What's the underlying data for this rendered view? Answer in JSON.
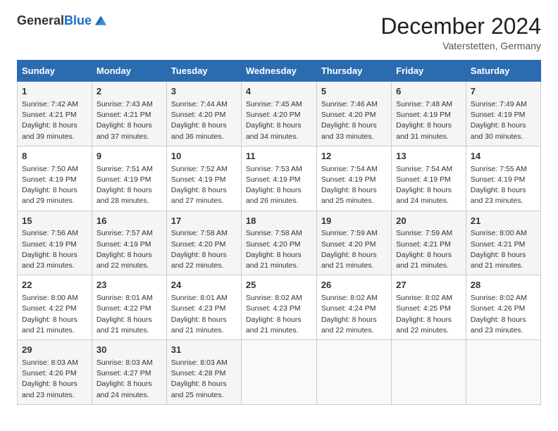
{
  "header": {
    "logo_general": "General",
    "logo_blue": "Blue",
    "month_title": "December 2024",
    "location": "Vaterstetten, Germany"
  },
  "days_of_week": [
    "Sunday",
    "Monday",
    "Tuesday",
    "Wednesday",
    "Thursday",
    "Friday",
    "Saturday"
  ],
  "weeks": [
    [
      {
        "day": 1,
        "sunrise": "Sunrise: 7:42 AM",
        "sunset": "Sunset: 4:21 PM",
        "daylight": "Daylight: 8 hours and 39 minutes."
      },
      {
        "day": 2,
        "sunrise": "Sunrise: 7:43 AM",
        "sunset": "Sunset: 4:21 PM",
        "daylight": "Daylight: 8 hours and 37 minutes."
      },
      {
        "day": 3,
        "sunrise": "Sunrise: 7:44 AM",
        "sunset": "Sunset: 4:20 PM",
        "daylight": "Daylight: 8 hours and 36 minutes."
      },
      {
        "day": 4,
        "sunrise": "Sunrise: 7:45 AM",
        "sunset": "Sunset: 4:20 PM",
        "daylight": "Daylight: 8 hours and 34 minutes."
      },
      {
        "day": 5,
        "sunrise": "Sunrise: 7:46 AM",
        "sunset": "Sunset: 4:20 PM",
        "daylight": "Daylight: 8 hours and 33 minutes."
      },
      {
        "day": 6,
        "sunrise": "Sunrise: 7:48 AM",
        "sunset": "Sunset: 4:19 PM",
        "daylight": "Daylight: 8 hours and 31 minutes."
      },
      {
        "day": 7,
        "sunrise": "Sunrise: 7:49 AM",
        "sunset": "Sunset: 4:19 PM",
        "daylight": "Daylight: 8 hours and 30 minutes."
      }
    ],
    [
      {
        "day": 8,
        "sunrise": "Sunrise: 7:50 AM",
        "sunset": "Sunset: 4:19 PM",
        "daylight": "Daylight: 8 hours and 29 minutes."
      },
      {
        "day": 9,
        "sunrise": "Sunrise: 7:51 AM",
        "sunset": "Sunset: 4:19 PM",
        "daylight": "Daylight: 8 hours and 28 minutes."
      },
      {
        "day": 10,
        "sunrise": "Sunrise: 7:52 AM",
        "sunset": "Sunset: 4:19 PM",
        "daylight": "Daylight: 8 hours and 27 minutes."
      },
      {
        "day": 11,
        "sunrise": "Sunrise: 7:53 AM",
        "sunset": "Sunset: 4:19 PM",
        "daylight": "Daylight: 8 hours and 26 minutes."
      },
      {
        "day": 12,
        "sunrise": "Sunrise: 7:54 AM",
        "sunset": "Sunset: 4:19 PM",
        "daylight": "Daylight: 8 hours and 25 minutes."
      },
      {
        "day": 13,
        "sunrise": "Sunrise: 7:54 AM",
        "sunset": "Sunset: 4:19 PM",
        "daylight": "Daylight: 8 hours and 24 minutes."
      },
      {
        "day": 14,
        "sunrise": "Sunrise: 7:55 AM",
        "sunset": "Sunset: 4:19 PM",
        "daylight": "Daylight: 8 hours and 23 minutes."
      }
    ],
    [
      {
        "day": 15,
        "sunrise": "Sunrise: 7:56 AM",
        "sunset": "Sunset: 4:19 PM",
        "daylight": "Daylight: 8 hours and 23 minutes."
      },
      {
        "day": 16,
        "sunrise": "Sunrise: 7:57 AM",
        "sunset": "Sunset: 4:19 PM",
        "daylight": "Daylight: 8 hours and 22 minutes."
      },
      {
        "day": 17,
        "sunrise": "Sunrise: 7:58 AM",
        "sunset": "Sunset: 4:20 PM",
        "daylight": "Daylight: 8 hours and 22 minutes."
      },
      {
        "day": 18,
        "sunrise": "Sunrise: 7:58 AM",
        "sunset": "Sunset: 4:20 PM",
        "daylight": "Daylight: 8 hours and 21 minutes."
      },
      {
        "day": 19,
        "sunrise": "Sunrise: 7:59 AM",
        "sunset": "Sunset: 4:20 PM",
        "daylight": "Daylight: 8 hours and 21 minutes."
      },
      {
        "day": 20,
        "sunrise": "Sunrise: 7:59 AM",
        "sunset": "Sunset: 4:21 PM",
        "daylight": "Daylight: 8 hours and 21 minutes."
      },
      {
        "day": 21,
        "sunrise": "Sunrise: 8:00 AM",
        "sunset": "Sunset: 4:21 PM",
        "daylight": "Daylight: 8 hours and 21 minutes."
      }
    ],
    [
      {
        "day": 22,
        "sunrise": "Sunrise: 8:00 AM",
        "sunset": "Sunset: 4:22 PM",
        "daylight": "Daylight: 8 hours and 21 minutes."
      },
      {
        "day": 23,
        "sunrise": "Sunrise: 8:01 AM",
        "sunset": "Sunset: 4:22 PM",
        "daylight": "Daylight: 8 hours and 21 minutes."
      },
      {
        "day": 24,
        "sunrise": "Sunrise: 8:01 AM",
        "sunset": "Sunset: 4:23 PM",
        "daylight": "Daylight: 8 hours and 21 minutes."
      },
      {
        "day": 25,
        "sunrise": "Sunrise: 8:02 AM",
        "sunset": "Sunset: 4:23 PM",
        "daylight": "Daylight: 8 hours and 21 minutes."
      },
      {
        "day": 26,
        "sunrise": "Sunrise: 8:02 AM",
        "sunset": "Sunset: 4:24 PM",
        "daylight": "Daylight: 8 hours and 22 minutes."
      },
      {
        "day": 27,
        "sunrise": "Sunrise: 8:02 AM",
        "sunset": "Sunset: 4:25 PM",
        "daylight": "Daylight: 8 hours and 22 minutes."
      },
      {
        "day": 28,
        "sunrise": "Sunrise: 8:02 AM",
        "sunset": "Sunset: 4:26 PM",
        "daylight": "Daylight: 8 hours and 23 minutes."
      }
    ],
    [
      {
        "day": 29,
        "sunrise": "Sunrise: 8:03 AM",
        "sunset": "Sunset: 4:26 PM",
        "daylight": "Daylight: 8 hours and 23 minutes."
      },
      {
        "day": 30,
        "sunrise": "Sunrise: 8:03 AM",
        "sunset": "Sunset: 4:27 PM",
        "daylight": "Daylight: 8 hours and 24 minutes."
      },
      {
        "day": 31,
        "sunrise": "Sunrise: 8:03 AM",
        "sunset": "Sunset: 4:28 PM",
        "daylight": "Daylight: 8 hours and 25 minutes."
      },
      null,
      null,
      null,
      null
    ]
  ]
}
